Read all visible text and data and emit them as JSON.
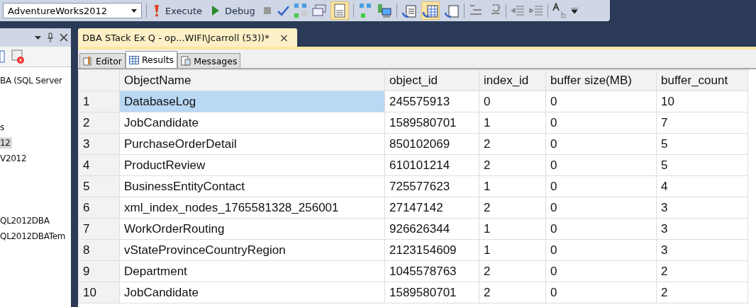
{
  "toolbar": {
    "database": "AdventureWorks2012",
    "execute": "Execute",
    "debug": "Debug"
  },
  "object_explorer": {
    "items": [
      {
        "text": "BA (SQL Server",
        "selected": false
      },
      {
        "text": "s",
        "selected": false
      },
      {
        "text": "12",
        "selected": true
      },
      {
        "text": "V2012",
        "selected": false
      },
      {
        "text": "QL2012DBA",
        "selected": false
      },
      {
        "text": "QL2012DBATem",
        "selected": false
      }
    ]
  },
  "document_tab": {
    "title": "DBA STack Ex Q - op...WIFI\\Jcarroll (53))*",
    "close": "×"
  },
  "result_tabs": [
    {
      "label": "Editor",
      "selected": false
    },
    {
      "label": "Results",
      "selected": true
    },
    {
      "label": "Messages",
      "selected": false
    }
  ],
  "table": {
    "columns": [
      "ObjectName",
      "object_id",
      "index_id",
      "buffer size(MB)",
      "buffer_count"
    ],
    "rows": [
      {
        "n": "1",
        "cells": [
          "DatabaseLog",
          "245575913",
          "0",
          "0",
          "10"
        ],
        "selected": true
      },
      {
        "n": "2",
        "cells": [
          "JobCandidate",
          "1589580701",
          "1",
          "0",
          "7"
        ],
        "selected": false
      },
      {
        "n": "3",
        "cells": [
          "PurchaseOrderDetail",
          "850102069",
          "2",
          "0",
          "5"
        ],
        "selected": false
      },
      {
        "n": "4",
        "cells": [
          "ProductReview",
          "610101214",
          "2",
          "0",
          "5"
        ],
        "selected": false
      },
      {
        "n": "5",
        "cells": [
          "BusinessEntityContact",
          "725577623",
          "1",
          "0",
          "4"
        ],
        "selected": false
      },
      {
        "n": "6",
        "cells": [
          "xml_index_nodes_1765581328_256001",
          "27147142",
          "2",
          "0",
          "3"
        ],
        "selected": false
      },
      {
        "n": "7",
        "cells": [
          "WorkOrderRouting",
          "926626344",
          "1",
          "0",
          "3"
        ],
        "selected": false
      },
      {
        "n": "8",
        "cells": [
          "vStateProvinceCountryRegion",
          "2123154609",
          "1",
          "0",
          "3"
        ],
        "selected": false
      },
      {
        "n": "9",
        "cells": [
          "Department",
          "1045578763",
          "2",
          "0",
          "2"
        ],
        "selected": false
      },
      {
        "n": "10",
        "cells": [
          "JobCandidate",
          "1589580701",
          "2",
          "0",
          "2"
        ],
        "selected": false
      }
    ]
  }
}
